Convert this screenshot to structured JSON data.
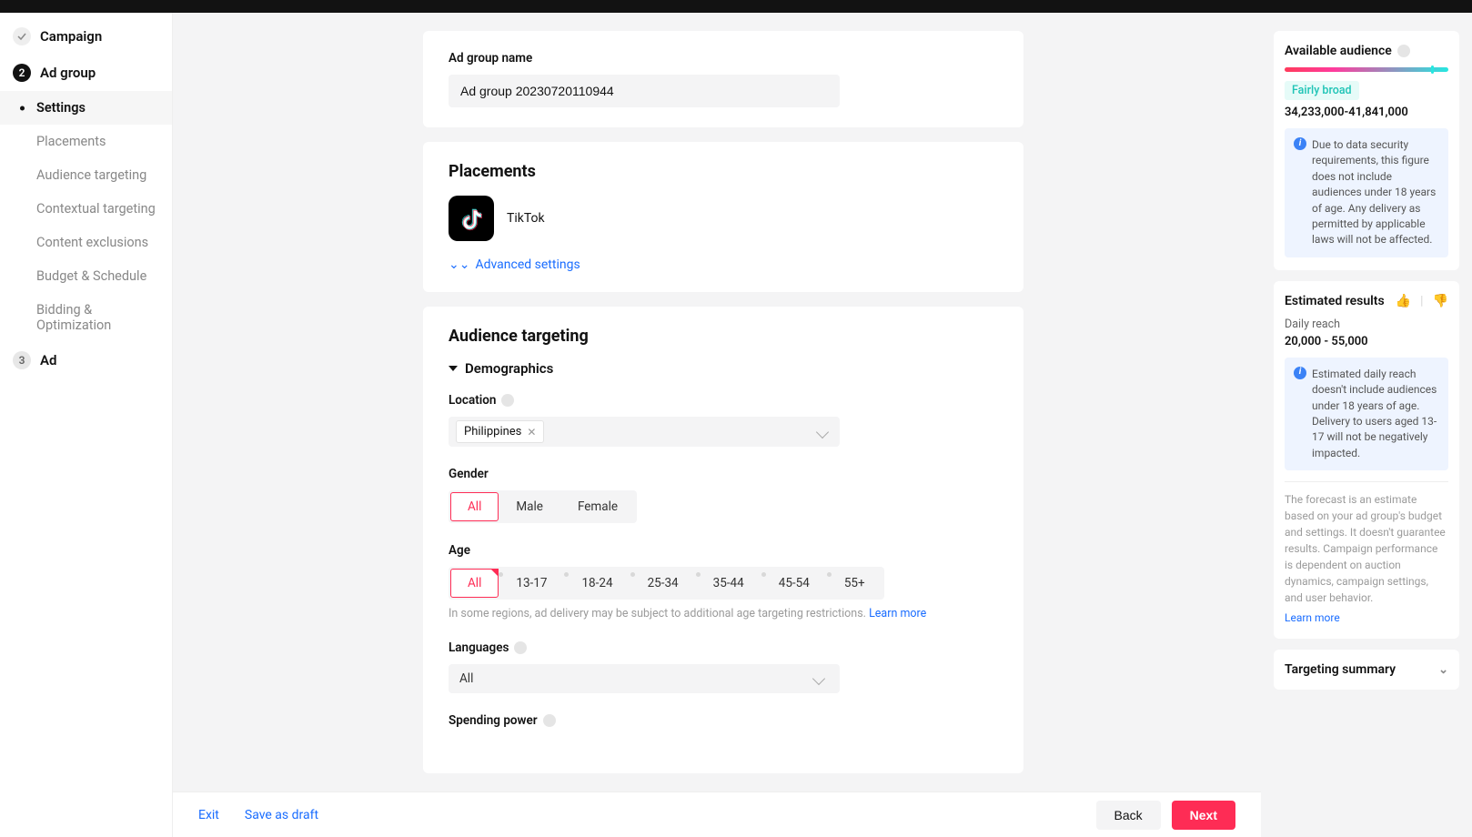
{
  "sidebar": {
    "steps": [
      {
        "label": "Campaign",
        "state": "done"
      },
      {
        "label": "Ad group",
        "state": "active",
        "num": "2"
      },
      {
        "label": "Ad",
        "state": "pending",
        "num": "3"
      }
    ],
    "subitems": [
      "Settings",
      "Placements",
      "Audience targeting",
      "Contextual targeting",
      "Content exclusions",
      "Budget & Schedule",
      "Bidding & Optimization"
    ],
    "active_sub": 0
  },
  "adgroup": {
    "name_label": "Ad group name",
    "name_value": "Ad group 20230720110944"
  },
  "placements": {
    "title": "Placements",
    "item": "TikTok",
    "advanced": "Advanced settings"
  },
  "audience": {
    "title": "Audience targeting",
    "demo_header": "Demographics",
    "location_label": "Location",
    "location_value": "Philippines",
    "gender_label": "Gender",
    "gender_options": [
      "All",
      "Male",
      "Female"
    ],
    "gender_selected": 0,
    "age_label": "Age",
    "age_options": [
      "All",
      "13-17",
      "18-24",
      "25-34",
      "35-44",
      "45-54",
      "55+"
    ],
    "age_selected": 0,
    "age_hint": "In some regions, ad delivery may be subject to additional age targeting restrictions.",
    "age_learn": "Learn more",
    "lang_label": "Languages",
    "lang_value": "All",
    "spending_label": "Spending power"
  },
  "right": {
    "available_title": "Available audience",
    "breadth": "Fairly broad",
    "range": "34,233,000-41,841,000",
    "security_note": "Due to data security requirements, this figure does not include audiences under 18 years of age. Any delivery as permitted by applicable laws will not be affected.",
    "estimated_title": "Estimated results",
    "daily_reach_label": "Daily reach",
    "daily_reach_value": "20,000 - 55,000",
    "reach_note": "Estimated daily reach doesn't include audiences under 18 years of age. Delivery to users aged 13-17 will not be negatively impacted.",
    "forecast_note": "The forecast is an estimate based on your ad group's budget and settings. It doesn't guarantee results. Campaign performance is dependent on auction dynamics, campaign settings, and user behavior.",
    "learn_more": "Learn more",
    "targeting_summary": "Targeting summary"
  },
  "footer": {
    "exit": "Exit",
    "save": "Save as draft",
    "back": "Back",
    "next": "Next"
  }
}
